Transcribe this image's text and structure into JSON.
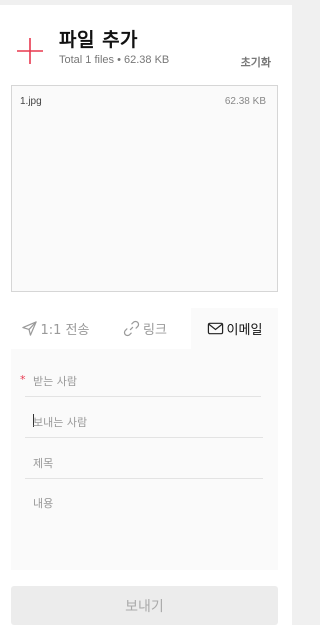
{
  "header": {
    "title": "파일 추가",
    "summary": "Total 1 files • 62.38 KB",
    "reset_label": "초기화",
    "accent_color": "#e8384f"
  },
  "files": [
    {
      "name": "1.jpg",
      "size": "62.38 KB"
    }
  ],
  "tabs": [
    {
      "label": "1:1 전송",
      "icon": "send-icon",
      "active": false
    },
    {
      "label": "링크",
      "icon": "link-icon",
      "active": false
    },
    {
      "label": "이메일",
      "icon": "mail-icon",
      "active": true
    }
  ],
  "form": {
    "recipient_required_mark": "*",
    "recipient_label": "받는 사람",
    "sender_label": "보내는 사람",
    "subject_label": "제목",
    "message_label": "내용"
  },
  "send_label": "보내기"
}
